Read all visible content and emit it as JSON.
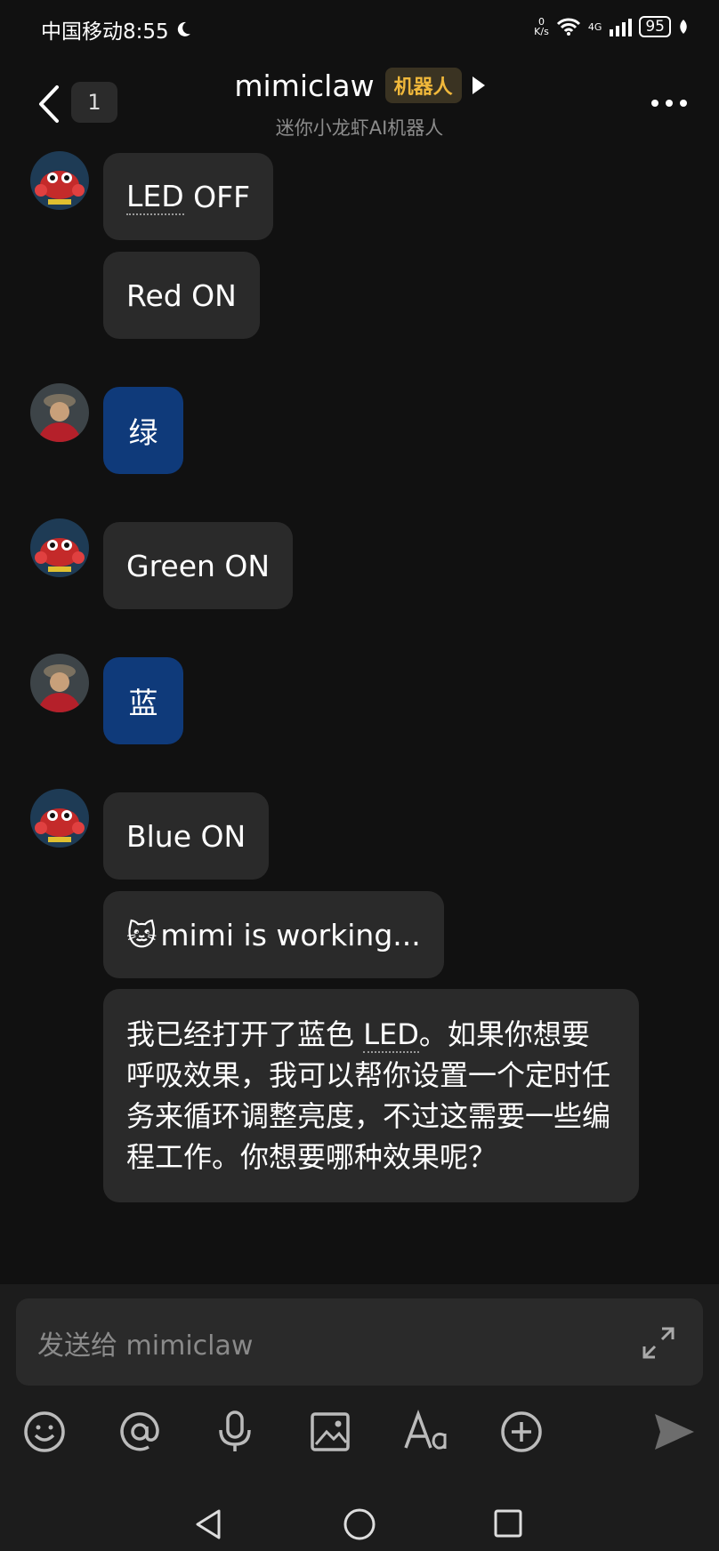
{
  "status_bar": {
    "carrier_time": "中国移动8:55",
    "net_speed_top": "0",
    "net_speed_unit": "K/s",
    "signal_label": "4G",
    "battery": "95"
  },
  "header": {
    "unread_count": "1",
    "title": "mimiclaw",
    "badge": "机器人",
    "subtitle": "迷你小龙虾AI机器人"
  },
  "messages": {
    "m1_a": "LED",
    "m1_b": " OFF",
    "m2": "Red ON",
    "m3": "绿",
    "m4": "Green ON",
    "m5": "蓝",
    "m6": "Blue ON",
    "m7_emoji": "🐱",
    "m7": "mimi is working...",
    "m8_a": "我已经打开了蓝色 ",
    "m8_led": "LED",
    "m8_b": "。如果你想要呼吸效果，我可以帮你设置一个定时任务来循环调整亮度，不过这需要一些编程工作。你想要哪种效果呢？"
  },
  "composer": {
    "placeholder": "发送给 mimiclaw"
  },
  "toolbar": {
    "icons": [
      "emoji-icon",
      "at-icon",
      "mic-icon",
      "image-icon",
      "font-icon",
      "plus-icon",
      "send-icon"
    ]
  },
  "colors": {
    "background": "#111111",
    "bot_bubble": "#2a2a2a",
    "user_bubble": "#0f3a7a",
    "badge_text": "#f0b83b"
  }
}
